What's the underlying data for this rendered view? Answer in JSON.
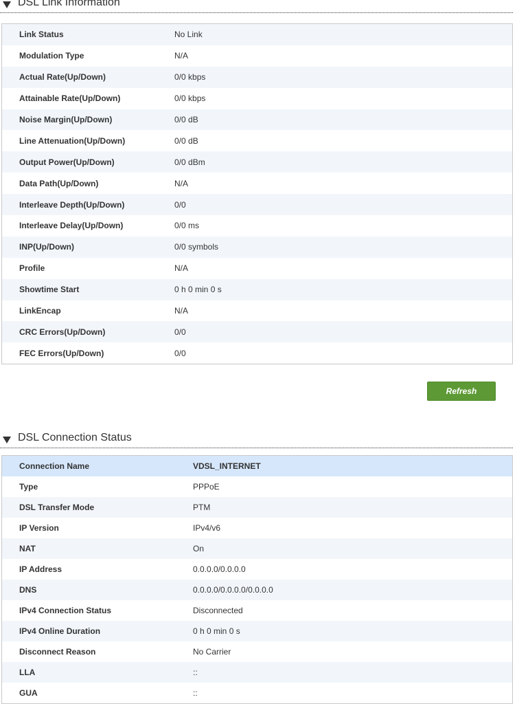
{
  "link_info": {
    "title": "DSL Link Information",
    "rows": [
      {
        "label": "Link Status",
        "value": "No Link"
      },
      {
        "label": "Modulation Type",
        "value": "N/A"
      },
      {
        "label": "Actual Rate(Up/Down)",
        "value": "0/0 kbps"
      },
      {
        "label": "Attainable Rate(Up/Down)",
        "value": "0/0 kbps"
      },
      {
        "label": "Noise Margin(Up/Down)",
        "value": "0/0 dB"
      },
      {
        "label": "Line Attenuation(Up/Down)",
        "value": "0/0 dB"
      },
      {
        "label": "Output Power(Up/Down)",
        "value": "0/0 dBm"
      },
      {
        "label": "Data Path(Up/Down)",
        "value": "N/A"
      },
      {
        "label": "Interleave Depth(Up/Down)",
        "value": "0/0"
      },
      {
        "label": "Interleave Delay(Up/Down)",
        "value": "0/0 ms"
      },
      {
        "label": "INP(Up/Down)",
        "value": "0/0 symbols"
      },
      {
        "label": "Profile",
        "value": "N/A"
      },
      {
        "label": "Showtime Start",
        "value": "0 h 0 min 0 s"
      },
      {
        "label": "LinkEncap",
        "value": "N/A"
      },
      {
        "label": "CRC Errors(Up/Down)",
        "value": "0/0"
      },
      {
        "label": "FEC Errors(Up/Down)",
        "value": "0/0"
      }
    ],
    "refresh_label": "Refresh"
  },
  "connection_status": {
    "title": "DSL Connection Status",
    "rows": [
      {
        "label": "Connection Name",
        "value": "VDSL_INTERNET"
      },
      {
        "label": "Type",
        "value": "PPPoE"
      },
      {
        "label": "DSL Transfer Mode",
        "value": "PTM"
      },
      {
        "label": "IP Version",
        "value": "IPv4/v6"
      },
      {
        "label": "NAT",
        "value": "On"
      },
      {
        "label": "IP Address",
        "value": "0.0.0.0/0.0.0.0"
      },
      {
        "label": "DNS",
        "value": "0.0.0.0/0.0.0.0/0.0.0.0"
      },
      {
        "label": "IPv4 Connection Status",
        "value": "Disconnected"
      },
      {
        "label": "IPv4 Online Duration",
        "value": "0 h 0 min 0 s"
      },
      {
        "label": "Disconnect Reason",
        "value": "No Carrier"
      },
      {
        "label": "LLA",
        "value": "::"
      },
      {
        "label": "GUA",
        "value": "::"
      }
    ]
  },
  "colors": {
    "header_row_bg": "#d6e7fb",
    "stripe_bg": "#f2f6fb",
    "button_green": "#5d9a35"
  },
  "icons": {
    "section_toggle": "triangle-down-icon"
  }
}
